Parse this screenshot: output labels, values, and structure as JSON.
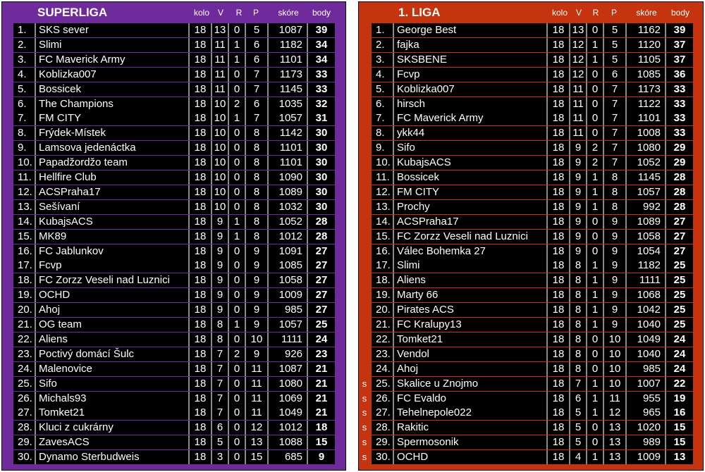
{
  "superliga": {
    "title": "SUPERLIGA",
    "headers": {
      "kolo": "kolo",
      "v": "V",
      "r": "R",
      "p": "P",
      "skore": "skóre",
      "body": "body"
    },
    "rows": [
      {
        "rank": "1.",
        "team": "SKS sever",
        "kolo": "18",
        "v": "13",
        "r": "0",
        "p": "5",
        "skore": "1087",
        "body": "39"
      },
      {
        "rank": "2.",
        "team": "Slimi",
        "kolo": "18",
        "v": "11",
        "r": "1",
        "p": "6",
        "skore": "1182",
        "body": "34"
      },
      {
        "rank": "3.",
        "team": "FC Maverick Army",
        "kolo": "18",
        "v": "11",
        "r": "1",
        "p": "6",
        "skore": "1101",
        "body": "34"
      },
      {
        "rank": "4.",
        "team": "Koblizka007",
        "kolo": "18",
        "v": "11",
        "r": "0",
        "p": "7",
        "skore": "1173",
        "body": "33"
      },
      {
        "rank": "5.",
        "team": "Bossicek",
        "kolo": "18",
        "v": "11",
        "r": "0",
        "p": "7",
        "skore": "1145",
        "body": "33"
      },
      {
        "rank": "6.",
        "team": "The Champions",
        "kolo": "18",
        "v": "10",
        "r": "2",
        "p": "6",
        "skore": "1035",
        "body": "32"
      },
      {
        "rank": "7.",
        "team": "FM CITY",
        "kolo": "18",
        "v": "10",
        "r": "1",
        "p": "7",
        "skore": "1057",
        "body": "31"
      },
      {
        "rank": "8.",
        "team": "Frýdek-Místek",
        "kolo": "18",
        "v": "10",
        "r": "0",
        "p": "8",
        "skore": "1142",
        "body": "30"
      },
      {
        "rank": "9.",
        "team": "Lamsova jedenáctka",
        "kolo": "18",
        "v": "10",
        "r": "0",
        "p": "8",
        "skore": "1101",
        "body": "30"
      },
      {
        "rank": "10.",
        "team": "Papadžordžo team",
        "kolo": "18",
        "v": "10",
        "r": "0",
        "p": "8",
        "skore": "1101",
        "body": "30"
      },
      {
        "rank": "11.",
        "team": "Hellfire Club",
        "kolo": "18",
        "v": "10",
        "r": "0",
        "p": "8",
        "skore": "1090",
        "body": "30"
      },
      {
        "rank": "12.",
        "team": "ACSPraha17",
        "kolo": "18",
        "v": "10",
        "r": "0",
        "p": "8",
        "skore": "1089",
        "body": "30"
      },
      {
        "rank": "13.",
        "team": "Sešívaní",
        "kolo": "18",
        "v": "10",
        "r": "0",
        "p": "8",
        "skore": "1032",
        "body": "30"
      },
      {
        "rank": "14.",
        "team": "KubajsACS",
        "kolo": "18",
        "v": "9",
        "r": "1",
        "p": "8",
        "skore": "1052",
        "body": "28"
      },
      {
        "rank": "15.",
        "team": "MK89",
        "kolo": "18",
        "v": "9",
        "r": "1",
        "p": "8",
        "skore": "1012",
        "body": "28"
      },
      {
        "rank": "16.",
        "team": "FC Jablunkov",
        "kolo": "18",
        "v": "9",
        "r": "0",
        "p": "9",
        "skore": "1091",
        "body": "27"
      },
      {
        "rank": "17.",
        "team": "Fcvp",
        "kolo": "18",
        "v": "9",
        "r": "0",
        "p": "9",
        "skore": "1085",
        "body": "27"
      },
      {
        "rank": "18.",
        "team": "FC Zorzz Veseli nad Luznici",
        "kolo": "18",
        "v": "9",
        "r": "0",
        "p": "9",
        "skore": "1058",
        "body": "27"
      },
      {
        "rank": "19.",
        "team": "OCHD",
        "kolo": "18",
        "v": "9",
        "r": "0",
        "p": "9",
        "skore": "1009",
        "body": "27"
      },
      {
        "rank": "20.",
        "team": "Ahoj",
        "kolo": "18",
        "v": "9",
        "r": "0",
        "p": "9",
        "skore": "985",
        "body": "27"
      },
      {
        "rank": "21.",
        "team": "OG team",
        "kolo": "18",
        "v": "8",
        "r": "1",
        "p": "9",
        "skore": "1057",
        "body": "25"
      },
      {
        "rank": "22.",
        "team": "Aliens",
        "kolo": "18",
        "v": "8",
        "r": "0",
        "p": "10",
        "skore": "1111",
        "body": "24"
      },
      {
        "rank": "23.",
        "team": "Poctivý domácí Šulc",
        "kolo": "18",
        "v": "7",
        "r": "2",
        "p": "9",
        "skore": "926",
        "body": "23"
      },
      {
        "rank": "24.",
        "team": "Malenovice",
        "kolo": "18",
        "v": "7",
        "r": "0",
        "p": "11",
        "skore": "1087",
        "body": "21"
      },
      {
        "rank": "25.",
        "team": "Sifo",
        "kolo": "18",
        "v": "7",
        "r": "0",
        "p": "11",
        "skore": "1080",
        "body": "21"
      },
      {
        "rank": "26.",
        "team": "Michals93",
        "kolo": "18",
        "v": "7",
        "r": "0",
        "p": "11",
        "skore": "1069",
        "body": "21"
      },
      {
        "rank": "27.",
        "team": "Tomket21",
        "kolo": "18",
        "v": "7",
        "r": "0",
        "p": "11",
        "skore": "1049",
        "body": "21"
      },
      {
        "rank": "28.",
        "team": "Kluci z cukrárny",
        "kolo": "18",
        "v": "6",
        "r": "0",
        "p": "12",
        "skore": "1012",
        "body": "18"
      },
      {
        "rank": "29.",
        "team": "ZavesACS",
        "kolo": "18",
        "v": "5",
        "r": "0",
        "p": "13",
        "skore": "1088",
        "body": "15"
      },
      {
        "rank": "30.",
        "team": "Dynamo Sterbudweis",
        "kolo": "18",
        "v": "3",
        "r": "0",
        "p": "15",
        "skore": "685",
        "body": "9"
      }
    ]
  },
  "liga1": {
    "title": "1. LIGA",
    "headers": {
      "kolo": "kolo",
      "v": "V",
      "r": "R",
      "p": "P",
      "skore": "skóre",
      "body": "body"
    },
    "rows": [
      {
        "s": "",
        "rank": "1.",
        "team": "George Best",
        "kolo": "18",
        "v": "13",
        "r": "0",
        "p": "5",
        "skore": "1162",
        "body": "39"
      },
      {
        "s": "",
        "rank": "2.",
        "team": "fajka",
        "kolo": "18",
        "v": "12",
        "r": "1",
        "p": "5",
        "skore": "1120",
        "body": "37"
      },
      {
        "s": "",
        "rank": "3.",
        "team": "SKSBENE",
        "kolo": "18",
        "v": "12",
        "r": "1",
        "p": "5",
        "skore": "1105",
        "body": "37"
      },
      {
        "s": "",
        "rank": "4.",
        "team": "Fcvp",
        "kolo": "18",
        "v": "12",
        "r": "0",
        "p": "6",
        "skore": "1085",
        "body": "36"
      },
      {
        "s": "",
        "rank": "5.",
        "team": "Koblizka007",
        "kolo": "18",
        "v": "11",
        "r": "0",
        "p": "7",
        "skore": "1173",
        "body": "33"
      },
      {
        "s": "",
        "rank": "6.",
        "team": "hirsch",
        "kolo": "18",
        "v": "11",
        "r": "0",
        "p": "7",
        "skore": "1122",
        "body": "33"
      },
      {
        "s": "",
        "rank": "7.",
        "team": "FC Maverick Army",
        "kolo": "18",
        "v": "11",
        "r": "0",
        "p": "7",
        "skore": "1101",
        "body": "33"
      },
      {
        "s": "",
        "rank": "8.",
        "team": "ykk44",
        "kolo": "18",
        "v": "11",
        "r": "0",
        "p": "7",
        "skore": "1008",
        "body": "33"
      },
      {
        "s": "",
        "rank": "9.",
        "team": "Sifo",
        "kolo": "18",
        "v": "9",
        "r": "2",
        "p": "7",
        "skore": "1080",
        "body": "29"
      },
      {
        "s": "",
        "rank": "10.",
        "team": "KubajsACS",
        "kolo": "18",
        "v": "9",
        "r": "2",
        "p": "7",
        "skore": "1052",
        "body": "29"
      },
      {
        "s": "",
        "rank": "11.",
        "team": "Bossicek",
        "kolo": "18",
        "v": "9",
        "r": "1",
        "p": "8",
        "skore": "1145",
        "body": "28"
      },
      {
        "s": "",
        "rank": "12.",
        "team": "FM CITY",
        "kolo": "18",
        "v": "9",
        "r": "1",
        "p": "8",
        "skore": "1057",
        "body": "28"
      },
      {
        "s": "",
        "rank": "13.",
        "team": "Prochy",
        "kolo": "18",
        "v": "9",
        "r": "1",
        "p": "8",
        "skore": "992",
        "body": "28"
      },
      {
        "s": "",
        "rank": "14.",
        "team": "ACSPraha17",
        "kolo": "18",
        "v": "9",
        "r": "0",
        "p": "9",
        "skore": "1089",
        "body": "27"
      },
      {
        "s": "",
        "rank": "15.",
        "team": "FC Zorzz Veseli nad Luznici",
        "kolo": "18",
        "v": "9",
        "r": "0",
        "p": "9",
        "skore": "1058",
        "body": "27"
      },
      {
        "s": "",
        "rank": "16.",
        "team": "Válec Bohemka 27",
        "kolo": "18",
        "v": "9",
        "r": "0",
        "p": "9",
        "skore": "1054",
        "body": "27"
      },
      {
        "s": "",
        "rank": "17.",
        "team": "Slimi",
        "kolo": "18",
        "v": "8",
        "r": "1",
        "p": "9",
        "skore": "1182",
        "body": "25"
      },
      {
        "s": "",
        "rank": "18.",
        "team": "Aliens",
        "kolo": "18",
        "v": "8",
        "r": "1",
        "p": "9",
        "skore": "1111",
        "body": "25"
      },
      {
        "s": "",
        "rank": "19.",
        "team": "Marty 66",
        "kolo": "18",
        "v": "8",
        "r": "1",
        "p": "9",
        "skore": "1068",
        "body": "25"
      },
      {
        "s": "",
        "rank": "20.",
        "team": "Pirates ACS",
        "kolo": "18",
        "v": "8",
        "r": "1",
        "p": "9",
        "skore": "1042",
        "body": "25"
      },
      {
        "s": "",
        "rank": "21.",
        "team": "FC Kralupy13",
        "kolo": "18",
        "v": "8",
        "r": "1",
        "p": "9",
        "skore": "1040",
        "body": "25"
      },
      {
        "s": "",
        "rank": "22.",
        "team": "Tomket21",
        "kolo": "18",
        "v": "8",
        "r": "0",
        "p": "10",
        "skore": "1049",
        "body": "24"
      },
      {
        "s": "",
        "rank": "23.",
        "team": "Vendol",
        "kolo": "18",
        "v": "8",
        "r": "0",
        "p": "10",
        "skore": "1040",
        "body": "24"
      },
      {
        "s": "",
        "rank": "24.",
        "team": "Ahoj",
        "kolo": "18",
        "v": "8",
        "r": "0",
        "p": "10",
        "skore": "985",
        "body": "24"
      },
      {
        "s": "s",
        "rank": "25.",
        "team": "Skalice u Znojmo",
        "kolo": "18",
        "v": "7",
        "r": "1",
        "p": "10",
        "skore": "1007",
        "body": "22"
      },
      {
        "s": "s",
        "rank": "26.",
        "team": "FC Evaldo",
        "kolo": "18",
        "v": "6",
        "r": "1",
        "p": "11",
        "skore": "955",
        "body": "19"
      },
      {
        "s": "s",
        "rank": "27.",
        "team": "Tehelnepole022",
        "kolo": "18",
        "v": "5",
        "r": "1",
        "p": "12",
        "skore": "965",
        "body": "16"
      },
      {
        "s": "s",
        "rank": "28.",
        "team": "Rakitic",
        "kolo": "18",
        "v": "5",
        "r": "0",
        "p": "13",
        "skore": "1020",
        "body": "15"
      },
      {
        "s": "s",
        "rank": "29.",
        "team": "Spermosonik",
        "kolo": "18",
        "v": "5",
        "r": "0",
        "p": "13",
        "skore": "989",
        "body": "15"
      },
      {
        "s": "s",
        "rank": "30.",
        "team": "OCHD",
        "kolo": "18",
        "v": "4",
        "r": "1",
        "p": "13",
        "skore": "1009",
        "body": "13"
      }
    ]
  }
}
